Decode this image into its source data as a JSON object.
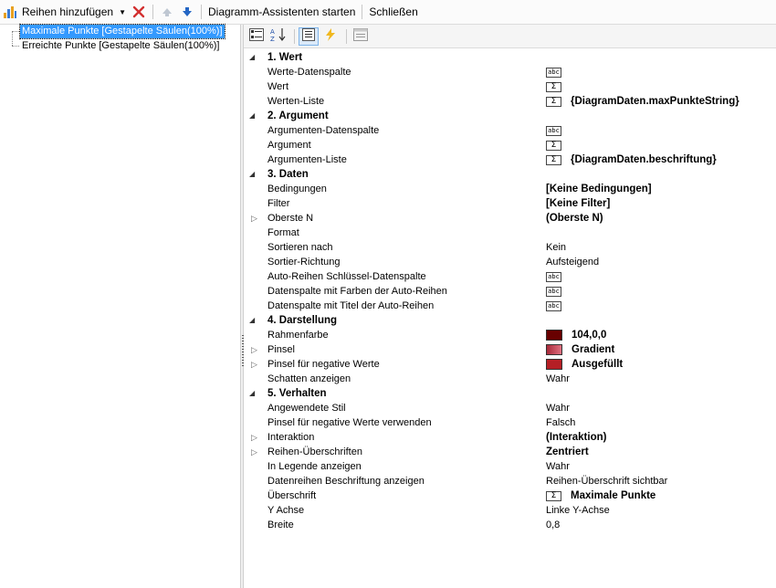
{
  "toolbar": {
    "add_series_label": "Reihen hinzufügen",
    "wizard_label": "Diagramm-Assistenten starten",
    "close_label": "Schließen"
  },
  "tree": {
    "items": [
      {
        "label": "Maximale Punkte [Gestapelte Säulen(100%)]",
        "selected": true
      },
      {
        "label": "Erreichte Punkte [Gestapelte Säulen(100%)]",
        "selected": false
      }
    ]
  },
  "grid": {
    "categories": [
      {
        "label": "1. Wert",
        "props": [
          {
            "name": "Werte-Datenspalte",
            "icon": "abc"
          },
          {
            "name": "Wert",
            "icon": "sigma"
          },
          {
            "name": "Werten-Liste",
            "icon": "sigma",
            "value": "{DiagramDaten.maxPunkteString}",
            "bold": true
          }
        ]
      },
      {
        "label": "2. Argument",
        "props": [
          {
            "name": "Argumenten-Datenspalte",
            "icon": "abc"
          },
          {
            "name": "Argument",
            "icon": "sigma"
          },
          {
            "name": "Argumenten-Liste",
            "icon": "sigma",
            "value": "{DiagramDaten.beschriftung}",
            "bold": true
          }
        ]
      },
      {
        "label": "3. Daten",
        "props": [
          {
            "name": "Bedingungen",
            "value": "[Keine Bedingungen]",
            "bold": true
          },
          {
            "name": "Filter",
            "value": "[Keine Filter]",
            "bold": true
          },
          {
            "name": "Oberste N",
            "value": "(Oberste N)",
            "bold": true,
            "expandable": true
          },
          {
            "name": "Format"
          },
          {
            "name": "Sortieren nach",
            "value": "Kein"
          },
          {
            "name": "Sortier-Richtung",
            "value": "Aufsteigend"
          },
          {
            "name": "Auto-Reihen Schlüssel-Datenspalte",
            "icon": "abc"
          },
          {
            "name": "Datenspalte mit Farben der Auto-Reihen",
            "icon": "abc"
          },
          {
            "name": "Datenspalte mit Titel der Auto-Reihen",
            "icon": "abc"
          }
        ]
      },
      {
        "label": "4. Darstellung",
        "props": [
          {
            "name": "Rahmenfarbe",
            "swatch": "#680000",
            "value": "104,0,0",
            "bold": true
          },
          {
            "name": "Pinsel",
            "swatch": "gradient",
            "value": "Gradient",
            "bold": true,
            "expandable": true
          },
          {
            "name": "Pinsel für negative Werte",
            "swatch": "#b51f25",
            "value": "Ausgefüllt",
            "bold": true,
            "expandable": true
          },
          {
            "name": "Schatten anzeigen",
            "value": "Wahr"
          }
        ]
      },
      {
        "label": "5. Verhalten",
        "props": [
          {
            "name": "Angewendete Stil",
            "value": "Wahr"
          },
          {
            "name": "Pinsel für negative Werte verwenden",
            "value": "Falsch"
          },
          {
            "name": "Interaktion",
            "value": "(Interaktion)",
            "bold": true,
            "expandable": true
          },
          {
            "name": "Reihen-Überschriften",
            "value": "Zentriert",
            "bold": true,
            "expandable": true
          },
          {
            "name": "In Legende anzeigen",
            "value": "Wahr"
          },
          {
            "name": "Datenreihen Beschriftung anzeigen",
            "value": "Reihen-Überschrift sichtbar"
          },
          {
            "name": "Überschrift",
            "icon": "sigma",
            "value": "Maximale Punkte",
            "bold": true
          },
          {
            "name": "Y Achse",
            "value": "Linke Y-Achse"
          },
          {
            "name": "Breite",
            "value": "0,8"
          }
        ]
      }
    ]
  },
  "icons": {
    "abc_text": "abc",
    "sigma_text": "Σ",
    "expand_glyph": "▷",
    "collapse_glyph": "◢"
  },
  "colors": {
    "selection": "#3399ff",
    "frame_color": "#680000",
    "negative_brush": "#b51f25",
    "gradient_from": "#a82a3a",
    "gradient_to": "#e07080"
  }
}
